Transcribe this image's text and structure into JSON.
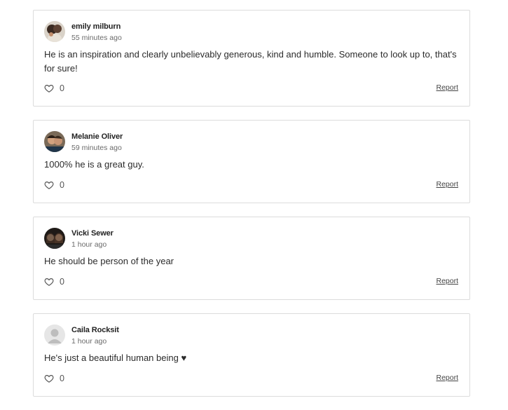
{
  "comments": [
    {
      "author": "emily milburn",
      "time": "55 minutes ago",
      "text": "He is an inspiration and clearly unbelievably generous, kind and humble. Someone to look up to, that's for sure!",
      "likes": "0",
      "report_label": "Report"
    },
    {
      "author": "Melanie Oliver",
      "time": "59 minutes ago",
      "text": "1000% he is a great guy.",
      "likes": "0",
      "report_label": "Report"
    },
    {
      "author": "Vicki Sewer",
      "time": "1 hour ago",
      "text": "He should be person of the year",
      "likes": "0",
      "report_label": "Report"
    },
    {
      "author": "Caila Rocksit",
      "time": "1 hour ago",
      "text": "He's just a beautiful human being ♥",
      "likes": "0",
      "report_label": "Report"
    }
  ],
  "colors": {
    "border": "#dcdcdc",
    "text": "#2b2b2b",
    "muted": "#6b6b6b"
  }
}
